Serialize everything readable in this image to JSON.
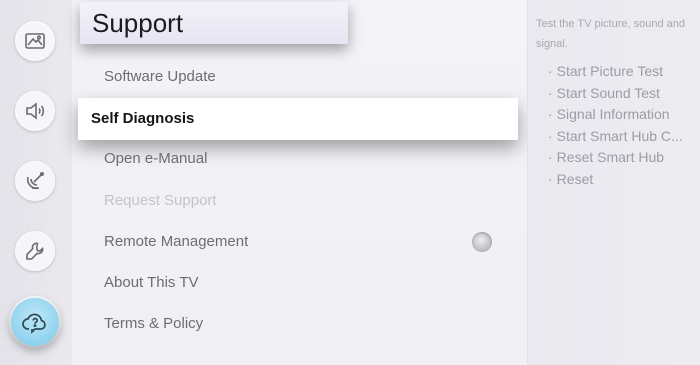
{
  "rail": {
    "items": [
      {
        "icon": "picture-icon",
        "active": false
      },
      {
        "icon": "sound-icon",
        "active": false
      },
      {
        "icon": "broadcast-icon",
        "active": false
      },
      {
        "icon": "wrench-icon",
        "active": false
      },
      {
        "icon": "support-cloud-icon",
        "active": true
      }
    ]
  },
  "menu": {
    "title": "Support",
    "items": [
      {
        "label": "Software Update",
        "state": "normal"
      },
      {
        "label": "Self Diagnosis",
        "state": "focused"
      },
      {
        "label": "Open e-Manual",
        "state": "normal"
      },
      {
        "label": "Request Support",
        "state": "disabled"
      },
      {
        "label": "Remote Management",
        "state": "normal",
        "toggle": "off"
      },
      {
        "label": "About This TV",
        "state": "normal"
      },
      {
        "label": "Terms & Policy",
        "state": "normal"
      }
    ]
  },
  "description": {
    "text": "Test the TV picture, sound and signal.",
    "bullet": "·",
    "items": [
      "Start Picture Test",
      "Start Sound Test",
      "Signal Information",
      "Start Smart Hub C...",
      "Reset Smart Hub",
      "Reset"
    ]
  },
  "colors": {
    "focus_bg": "#ffffff",
    "active_icon_accent": "#8fd3ee",
    "text_dark": "#15151a",
    "text_muted": "#6c6c74",
    "text_disabled": "#c3c3cb"
  }
}
